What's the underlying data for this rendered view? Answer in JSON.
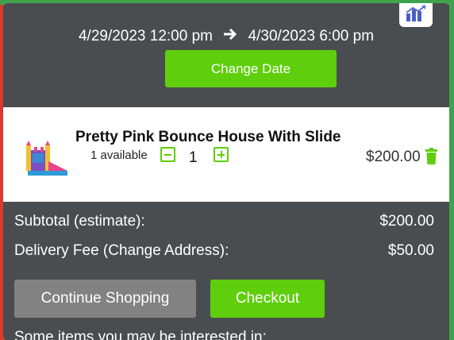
{
  "header": {
    "start_datetime": "4/29/2023 12:00 pm",
    "end_datetime": "4/30/2023 6:00 pm",
    "change_date_label": "Change Date",
    "corner_icon": "chart-logo-icon"
  },
  "cart": {
    "item": {
      "name": "Pretty Pink Bounce House With Slide",
      "availability": "1 available",
      "quantity": "1",
      "price": "$200.00",
      "remove_icon": "trash-icon"
    },
    "subtotal_label": "Subtotal (estimate):",
    "subtotal_value": "$200.00",
    "delivery_label": "Delivery Fee (Change Address):",
    "delivery_value": "$50.00"
  },
  "actions": {
    "continue_label": "Continue Shopping",
    "checkout_label": "Checkout"
  },
  "suggestions": {
    "heading": "Some items you may be interested in:"
  },
  "colors": {
    "panel_bg": "#4a4d50",
    "accent_green": "#5fce0c",
    "continue_gray": "#828282"
  }
}
